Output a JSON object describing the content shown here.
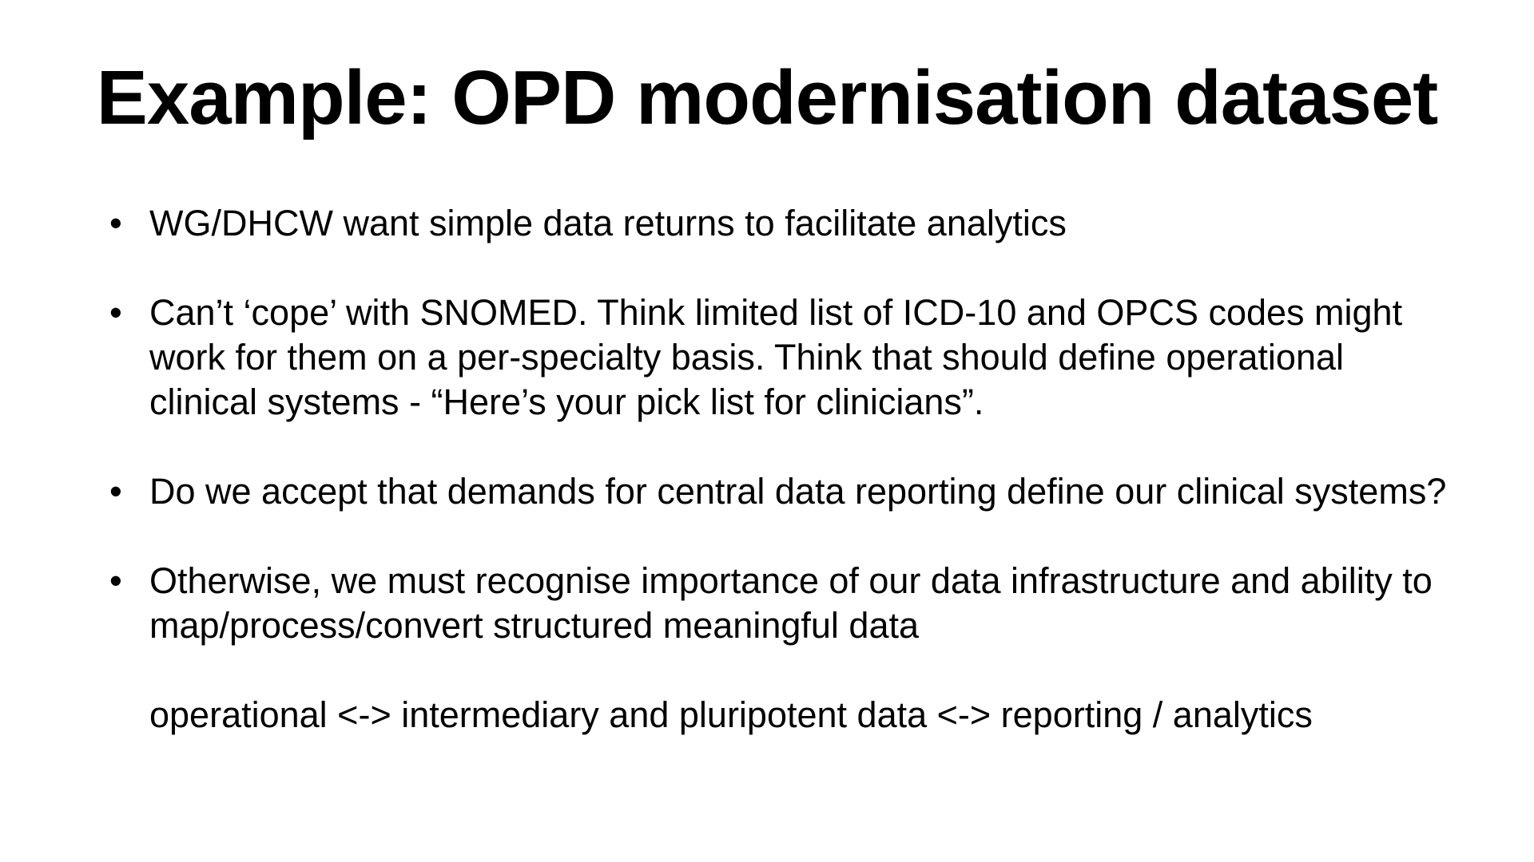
{
  "slide": {
    "title": "Example: OPD modernisation dataset",
    "bullet_glyph": "•",
    "bullets": [
      {
        "text": "WG/DHCW want simple data returns to facilitate analytics"
      },
      {
        "text": "Can’t ‘cope’ with SNOMED. Think limited list of ICD-10 and OPCS codes might work for them on a per-specialty basis. Think that should define operational clinical systems - “Here’s your pick list for clinicians”."
      },
      {
        "text": "Do we accept that demands for central data reporting define our clinical systems?"
      },
      {
        "text": "Otherwise, we must recognise importance of our data infrastructure and ability to map/process/convert structured meaningful data",
        "sub_text": "operational <-> intermediary and pluripotent data <-> reporting / analytics"
      }
    ]
  }
}
